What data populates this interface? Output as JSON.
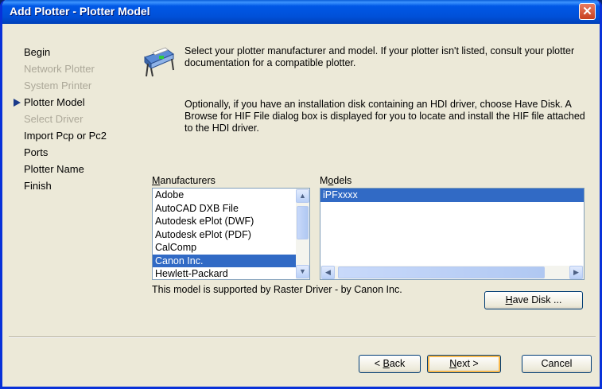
{
  "window": {
    "title": "Add Plotter - Plotter Model",
    "close_glyph": "✕"
  },
  "steps": [
    {
      "label": "Begin",
      "state": "normal"
    },
    {
      "label": "Network Plotter",
      "state": "disabled"
    },
    {
      "label": "System Printer",
      "state": "disabled"
    },
    {
      "label": "Plotter Model",
      "state": "current"
    },
    {
      "label": "Select Driver",
      "state": "disabled"
    },
    {
      "label": "Import Pcp or Pc2",
      "state": "normal"
    },
    {
      "label": "Ports",
      "state": "normal"
    },
    {
      "label": "Plotter Name",
      "state": "normal"
    },
    {
      "label": "Finish",
      "state": "normal"
    }
  ],
  "description": {
    "paragraph1": "Select your plotter manufacturer and model. If your plotter isn't listed, consult your plotter documentation for a compatible plotter.",
    "paragraph2": "Optionally, if you have an installation disk containing an HDI driver, choose Have Disk. A Browse for HIF File dialog box is displayed for you to locate and install the HIF file attached to the HDI driver."
  },
  "manufacturers": {
    "label_prefix": "M",
    "label_rest": "anufacturers",
    "items": [
      "Adobe",
      "AutoCAD DXB File",
      "Autodesk ePlot (DWF)",
      "Autodesk ePlot (PDF)",
      "CalComp",
      "Canon Inc.",
      "Hewlett-Packard"
    ],
    "selected": "Canon Inc."
  },
  "models": {
    "label_prefix": "M",
    "label_u": "o",
    "label_rest": "dels",
    "items": [
      "iPFxxxx"
    ],
    "selected": "iPFxxxx"
  },
  "support_text": "This model is supported by Raster Driver - by Canon Inc.",
  "buttons": {
    "have_disk_u": "H",
    "have_disk_rest": "ave Disk ...",
    "back_pre": "< ",
    "back_u": "B",
    "back_rest": "ack",
    "next_u": "N",
    "next_rest": "ext >",
    "cancel": "Cancel"
  },
  "icons": {
    "plotter": "plotter-icon",
    "scroll_up": "▲",
    "scroll_down": "▼",
    "scroll_left": "◀",
    "scroll_right": "▶"
  },
  "colors": {
    "title_bar": "#0058e6",
    "selection": "#316ac5",
    "dialog_bg": "#ece9d8"
  }
}
